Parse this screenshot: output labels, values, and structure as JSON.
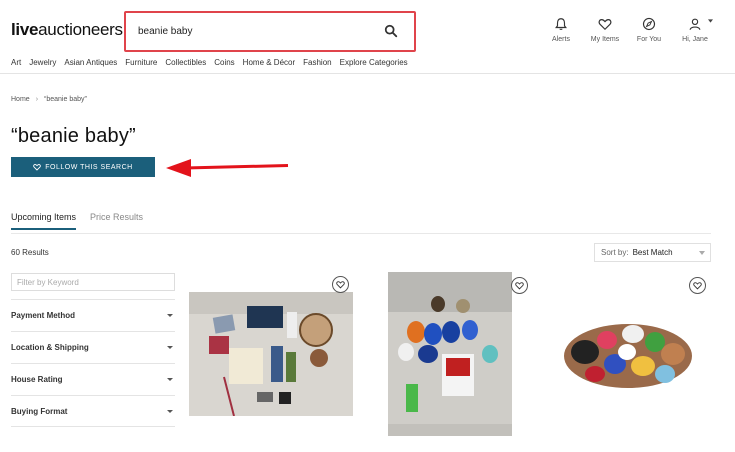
{
  "header": {
    "logo_bold": "live",
    "logo_light": "auctioneers",
    "search_value": "beanie baby",
    "nav": [
      {
        "label": "Alerts",
        "icon": "bell-icon"
      },
      {
        "label": "My Items",
        "icon": "heart-icon"
      },
      {
        "label": "For You",
        "icon": "compass-icon"
      },
      {
        "label": "Hi, Jane",
        "icon": "user-icon"
      }
    ]
  },
  "categories": [
    "Art",
    "Jewelry",
    "Asian Antiques",
    "Furniture",
    "Collectibles",
    "Coins",
    "Home & Décor",
    "Fashion",
    "Explore Categories"
  ],
  "breadcrumb": {
    "home": "Home",
    "separator": "›",
    "current": "“beanie baby”"
  },
  "page_title": "“beanie baby”",
  "follow_button": "FOLLOW THIS SEARCH",
  "tabs": [
    {
      "label": "Upcoming Items",
      "active": true
    },
    {
      "label": "Price Results",
      "active": false
    }
  ],
  "results_count": "60 Results",
  "sort": {
    "label": "Sort by:",
    "value": "Best Match"
  },
  "filter_placeholder": "Filter by Keyword",
  "facets": [
    "Payment Method",
    "Location & Shipping",
    "House Rating",
    "Buying Format"
  ],
  "colors": {
    "accent": "#1b5f7b",
    "highlight_red": "#e0444b",
    "arrow_red": "#e3131b"
  }
}
